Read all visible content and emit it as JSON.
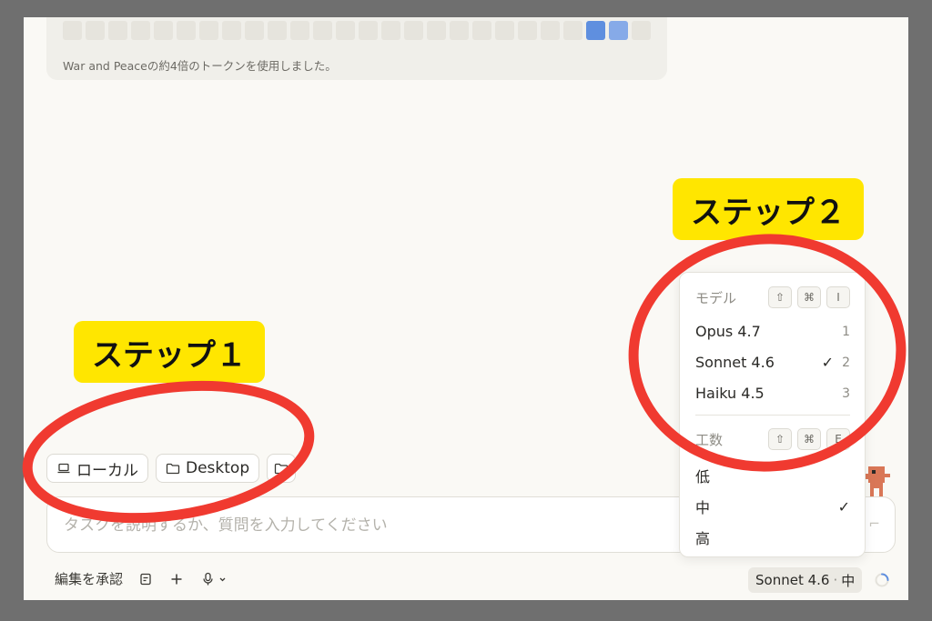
{
  "usage": {
    "note": "War and Peaceの約4倍のトークンを使用しました。",
    "cells_total": 26,
    "cells_active": [
      23,
      24
    ]
  },
  "chips": [
    {
      "icon": "laptop-icon",
      "label": "ローカル"
    },
    {
      "icon": "folder-icon",
      "label": "Desktop"
    },
    {
      "icon": "folder-icon",
      "label": ""
    }
  ],
  "input": {
    "placeholder": "タスクを説明するか、質問を入力してください",
    "value": ""
  },
  "bottom_bar": {
    "approve_label": "編集を承認",
    "model_label": "Sonnet 4.6",
    "effort_label": "中"
  },
  "menu": {
    "model_header": "モデル",
    "model_shortcut": [
      "⇧",
      "⌘",
      "I"
    ],
    "models": [
      {
        "label": "Opus 4.7",
        "key": "1",
        "selected": false
      },
      {
        "label": "Sonnet 4.6",
        "key": "2",
        "selected": true
      },
      {
        "label": "Haiku 4.5",
        "key": "3",
        "selected": false
      }
    ],
    "effort_header": "工数",
    "effort_shortcut": [
      "⇧",
      "⌘",
      "E"
    ],
    "efforts": [
      {
        "label": "低",
        "selected": false
      },
      {
        "label": "中",
        "selected": true
      },
      {
        "label": "高",
        "selected": false
      }
    ],
    "check_mark": "✓"
  },
  "annotations": {
    "step1": "ステップ１",
    "step2": "ステップ２",
    "highlight_color": "#ffe600",
    "circle_color": "#f03a30"
  },
  "colors": {
    "accent_blue": "#5f8fdf",
    "mascot": "#d97757"
  }
}
